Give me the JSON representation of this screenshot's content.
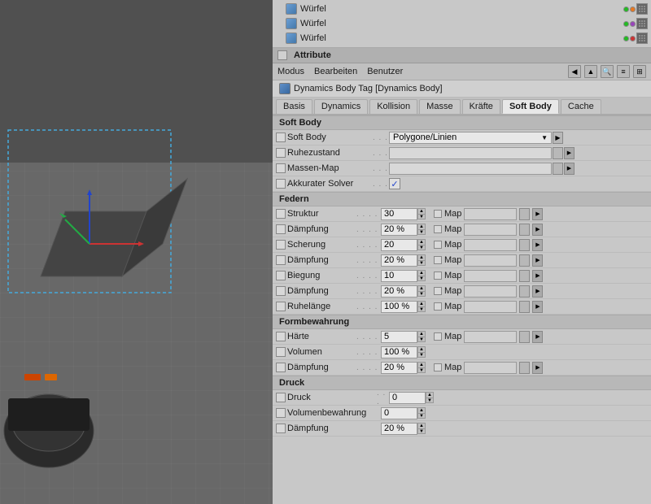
{
  "viewport": {
    "background": "#646464"
  },
  "object_list": {
    "items": [
      {
        "label": "Würfel",
        "dots": [
          "green",
          "orange",
          "gray",
          "grid"
        ]
      },
      {
        "label": "Würfel",
        "dots": [
          "green",
          "purple",
          "gray",
          "grid"
        ]
      },
      {
        "label": "Würfel",
        "dots": [
          "green",
          "red",
          "gray",
          "grid"
        ]
      }
    ]
  },
  "attribute_panel": {
    "title": "Attribute",
    "menu": {
      "modus": "Modus",
      "bearbeiten": "Bearbeiten",
      "benutzer": "Benutzer"
    },
    "tag_label": "Dynamics Body Tag [Dynamics Body]",
    "tabs": [
      "Basis",
      "Dynamics",
      "Kollision",
      "Masse",
      "Kräfte",
      "Soft Body",
      "Cache"
    ],
    "active_tab": "Soft Body",
    "sections": {
      "soft_body": {
        "header": "Soft Body",
        "rows": [
          {
            "label": "Soft Body",
            "dots": true,
            "type": "dropdown",
            "value": "Polygone/Linien"
          },
          {
            "label": "Ruhezustand",
            "dots": true,
            "type": "text_input",
            "value": ""
          },
          {
            "label": "Massen-Map",
            "dots": true,
            "type": "text_input",
            "value": ""
          },
          {
            "label": "Akkurater Solver",
            "dots": true,
            "type": "checkbox_val",
            "value": true
          }
        ]
      },
      "federn": {
        "header": "Federn",
        "rows": [
          {
            "label": "Struktur",
            "dots": true,
            "type": "spinner",
            "value": "30",
            "has_map": true
          },
          {
            "label": "Dämpfung",
            "dots": true,
            "type": "spinner",
            "value": "20 %",
            "has_map": true
          },
          {
            "label": "Scherung",
            "dots": true,
            "type": "spinner",
            "value": "20",
            "has_map": true
          },
          {
            "label": "Dämpfung",
            "dots": true,
            "type": "spinner",
            "value": "20 %",
            "has_map": true
          },
          {
            "label": "Biegung",
            "dots": true,
            "type": "spinner",
            "value": "10",
            "has_map": true
          },
          {
            "label": "Dämpfung",
            "dots": true,
            "type": "spinner",
            "value": "20 %",
            "has_map": true
          },
          {
            "label": "Ruhelänge",
            "dots": true,
            "type": "spinner",
            "value": "100 %",
            "has_map": true
          }
        ]
      },
      "formbewahrung": {
        "header": "Formbewahrung",
        "rows": [
          {
            "label": "Härte",
            "dots": true,
            "type": "spinner",
            "value": "5",
            "has_map": true
          },
          {
            "label": "Volumen",
            "dots": true,
            "type": "spinner",
            "value": "100 %",
            "has_map": false
          },
          {
            "label": "Dämpfung",
            "dots": true,
            "type": "spinner",
            "value": "20 %",
            "has_map": true
          }
        ]
      },
      "druck": {
        "header": "Druck",
        "rows": [
          {
            "label": "Druck",
            "dots": true,
            "type": "spinner",
            "value": "0"
          },
          {
            "label": "Volumenbewahrung",
            "dots": true,
            "type": "spinner",
            "value": "0"
          },
          {
            "label": "Dämpfung",
            "dots": true,
            "type": "spinner",
            "value": "20 %"
          }
        ]
      }
    }
  }
}
